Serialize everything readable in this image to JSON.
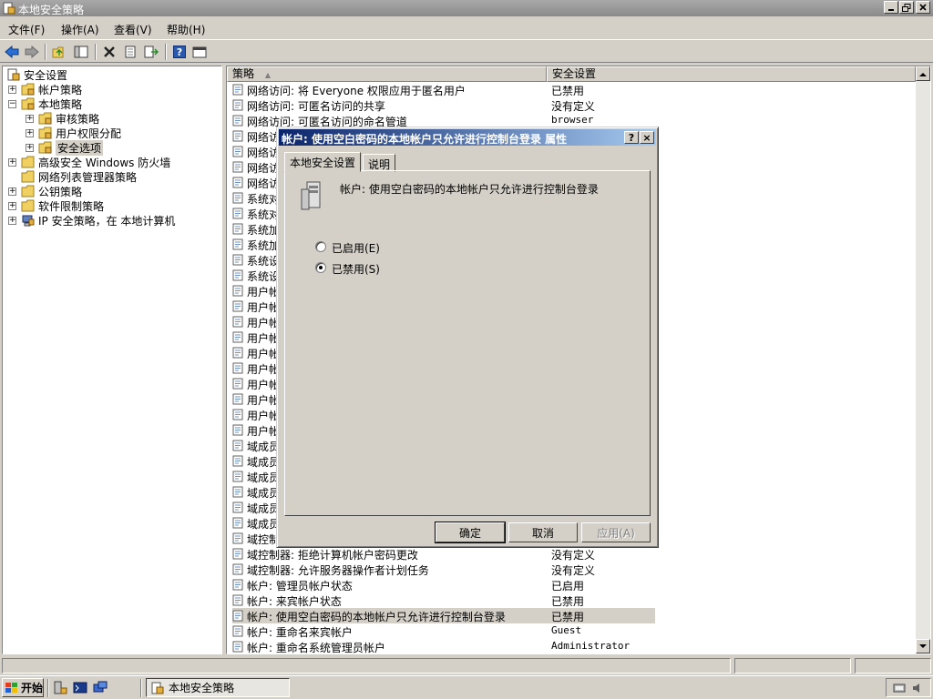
{
  "window": {
    "title": "本地安全策略"
  },
  "menu": [
    "文件(F)",
    "操作(A)",
    "查看(V)",
    "帮助(H)"
  ],
  "tree": {
    "root": "安全设置",
    "nodes": {
      "account_policy": "帐户策略",
      "local_policy": "本地策略",
      "audit_policy": "审核策略",
      "user_rights": "用户权限分配",
      "security_options": "安全选项",
      "firewall": "高级安全 Windows 防火墙",
      "netlist": "网络列表管理器策略",
      "pubkey": "公钥策略",
      "software_restriction": "软件限制策略",
      "ipsec": "IP 安全策略，在 本地计算机"
    }
  },
  "list": {
    "col_policy": "策略",
    "col_setting": "安全设置",
    "rows": [
      {
        "name": "网络访问: 将 Everyone 权限应用于匿名用户",
        "value": "已禁用"
      },
      {
        "name": "网络访问: 可匿名访问的共享",
        "value": "没有定义"
      },
      {
        "name": "网络访问: 可匿名访问的命名管道",
        "value": "browser"
      },
      {
        "name": "网络访",
        "value": ""
      },
      {
        "name": "网络访",
        "value": ""
      },
      {
        "name": "网络访",
        "value": ""
      },
      {
        "name": "网络访",
        "value": ""
      },
      {
        "name": "系统对",
        "value": ""
      },
      {
        "name": "系统对",
        "value": ""
      },
      {
        "name": "系统加",
        "value": ""
      },
      {
        "name": "系统加",
        "value": ""
      },
      {
        "name": "系统设",
        "value": ""
      },
      {
        "name": "系统设",
        "value": ""
      },
      {
        "name": "用户帐",
        "value": ""
      },
      {
        "name": "用户帐",
        "value": ""
      },
      {
        "name": "用户帐",
        "value": ""
      },
      {
        "name": "用户帐",
        "value": ""
      },
      {
        "name": "用户帐",
        "value": ""
      },
      {
        "name": "用户帐",
        "value": ""
      },
      {
        "name": "用户帐",
        "value": ""
      },
      {
        "name": "用户帐",
        "value": ""
      },
      {
        "name": "用户帐",
        "value": ""
      },
      {
        "name": "用户帐",
        "value": ""
      },
      {
        "name": "域成员",
        "value": ""
      },
      {
        "name": "域成员",
        "value": ""
      },
      {
        "name": "域成员",
        "value": ""
      },
      {
        "name": "域成员",
        "value": ""
      },
      {
        "name": "域成员",
        "value": ""
      },
      {
        "name": "域成员",
        "value": ""
      },
      {
        "name": "域控制",
        "value": ""
      },
      {
        "name": "域控制器: 拒绝计算机帐户密码更改",
        "value": "没有定义"
      },
      {
        "name": "域控制器: 允许服务器操作者计划任务",
        "value": "没有定义"
      },
      {
        "name": "帐户: 管理员帐户状态",
        "value": "已启用"
      },
      {
        "name": "帐户: 来宾帐户状态",
        "value": "已禁用"
      },
      {
        "name": "帐户: 使用空白密码的本地帐户只允许进行控制台登录",
        "value": "已禁用"
      },
      {
        "name": "帐户: 重命名来宾帐户",
        "value": "Guest"
      },
      {
        "name": "帐户: 重命名系统管理员帐户",
        "value": "Administrator"
      }
    ],
    "selected_index": 34
  },
  "dialog": {
    "title": "帐户: 使用空白密码的本地帐户只允许进行控制台登录 属性",
    "help_label": "?",
    "close_label": "×",
    "tabs": [
      "本地安全设置",
      "说明"
    ],
    "policy_desc": "帐户: 使用空白密码的本地帐户只允许进行控制台登录",
    "options": [
      {
        "label": "已启用(E)",
        "selected": false
      },
      {
        "label": "已禁用(S)",
        "selected": true
      }
    ],
    "buttons": {
      "ok": "确定",
      "cancel": "取消",
      "apply": "应用(A)"
    }
  },
  "taskbar": {
    "start": "开始",
    "active_item": "本地安全策略"
  },
  "colors": {
    "dialog_title_start": "#0a246a",
    "dialog_title_end": "#a6caf0",
    "face": "#d4d0c8"
  }
}
